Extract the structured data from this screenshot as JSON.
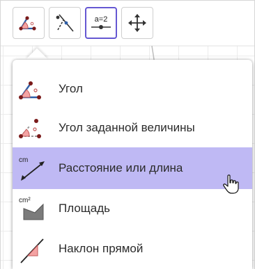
{
  "toolbar": {
    "tools": [
      {
        "icon": "angle-tool-icon",
        "state": "active"
      },
      {
        "icon": "perpendicular-line-tool-icon",
        "state": "normal"
      },
      {
        "icon": "slider-tool-icon",
        "state": "selected",
        "text": "a=2"
      },
      {
        "icon": "move-graphics-view-icon",
        "state": "normal"
      }
    ]
  },
  "menu": {
    "items": [
      {
        "label": "Угол",
        "icon": "angle-icon",
        "hover": false
      },
      {
        "label": "Угол заданной величины",
        "icon": "angle-fixed-size-icon",
        "hover": false
      },
      {
        "label": "Расстояние или длина",
        "icon": "distance-length-icon",
        "icon_text": "cm",
        "hover": true
      },
      {
        "label": "Площадь",
        "icon": "area-icon",
        "icon_text": "cm²",
        "hover": false
      },
      {
        "label": "Наклон прямой",
        "icon": "slope-icon",
        "hover": false
      }
    ]
  },
  "colors": {
    "selected_border": "#6557d2",
    "hover_background": "#bfb9f4",
    "angle_fill": "#f4a3a3",
    "point_dark": "#7a1a1a",
    "icon_blue": "#2f5fa8"
  }
}
